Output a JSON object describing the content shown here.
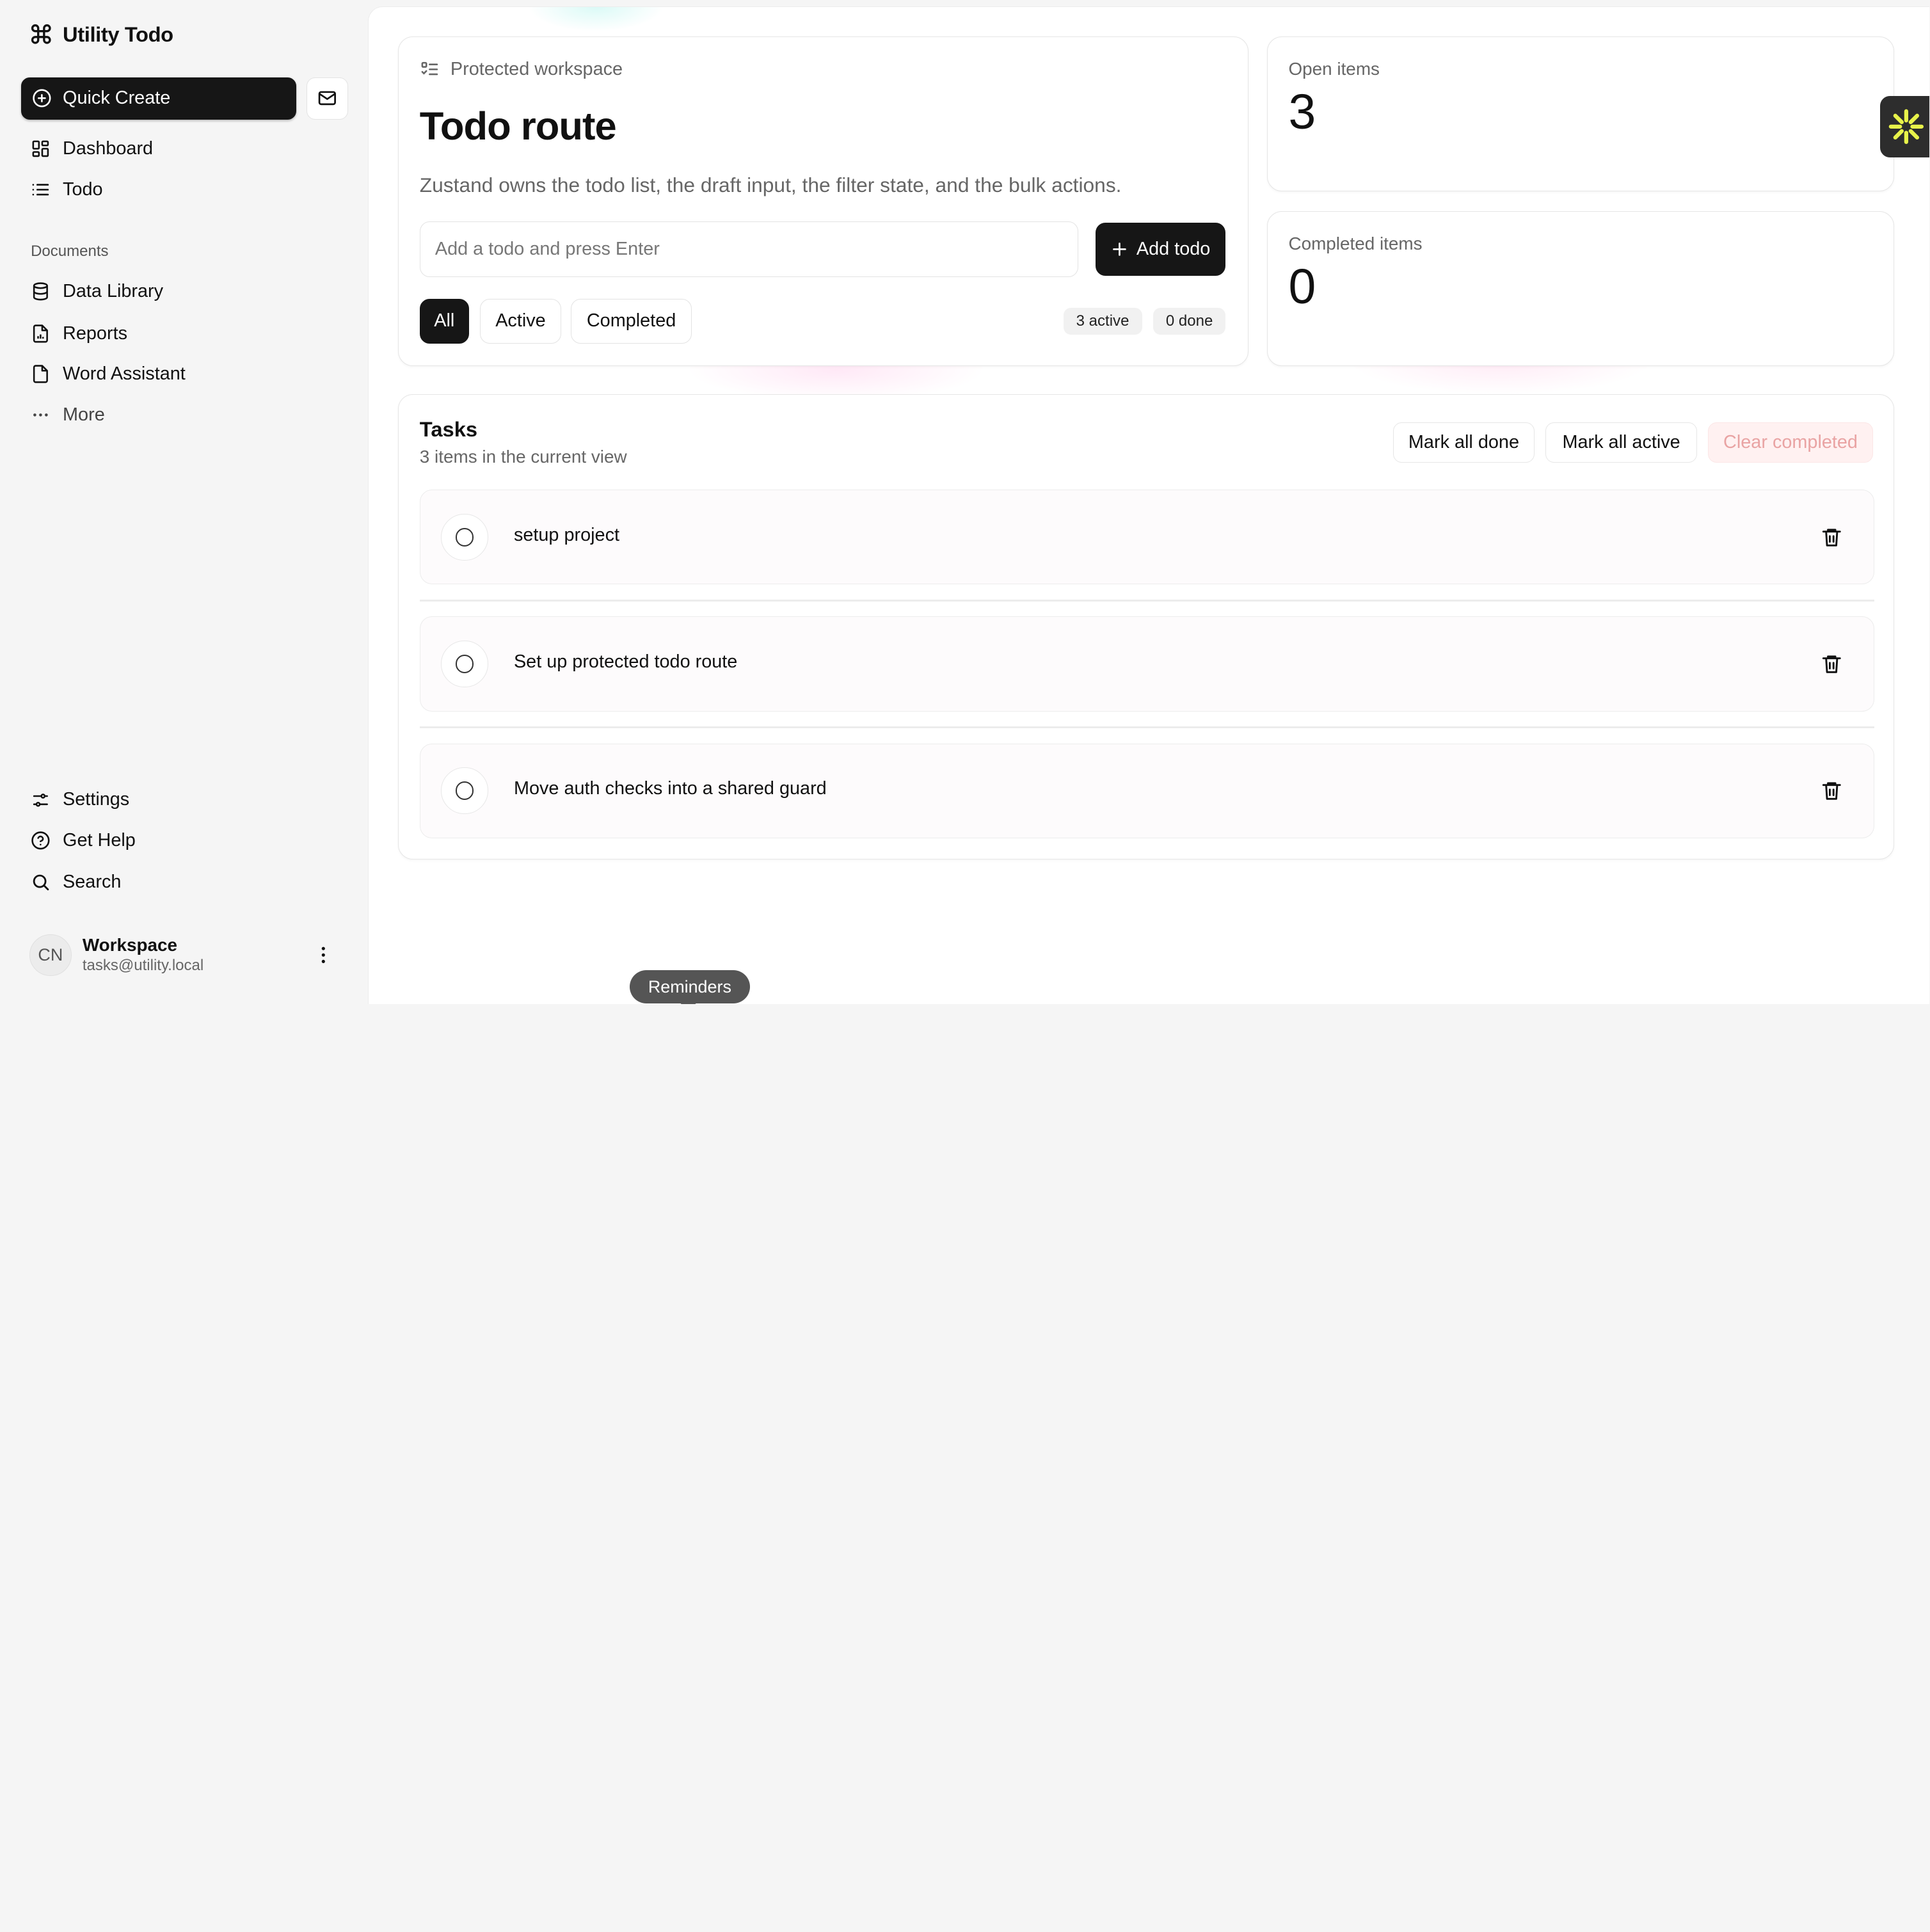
{
  "brand": {
    "name": "Utility Todo"
  },
  "sidebar": {
    "quick_create": "Quick Create",
    "nav": [
      {
        "label": "Dashboard",
        "icon": "dashboard-icon"
      },
      {
        "label": "Todo",
        "icon": "list-icon"
      }
    ],
    "documents_label": "Documents",
    "documents": [
      {
        "label": "Data Library",
        "icon": "database-icon"
      },
      {
        "label": "Reports",
        "icon": "report-icon"
      },
      {
        "label": "Word Assistant",
        "icon": "file-icon"
      },
      {
        "label": "More",
        "icon": "more-horizontal-icon"
      }
    ],
    "bottom": [
      {
        "label": "Settings",
        "icon": "settings-icon"
      },
      {
        "label": "Get Help",
        "icon": "help-icon"
      },
      {
        "label": "Search",
        "icon": "search-icon"
      }
    ],
    "user": {
      "initials": "CN",
      "name": "Workspace",
      "email": "tasks@utility.local"
    }
  },
  "hero": {
    "eyebrow": "Protected workspace",
    "title": "Todo route",
    "description": "Zustand owns the todo list, the draft input, the filter state, and the bulk actions.",
    "input_placeholder": "Add a todo and press Enter",
    "input_value": "",
    "add_label": "Add todo",
    "filters": [
      "All",
      "Active",
      "Completed"
    ],
    "selected_filter": "All",
    "active_pill": "3 active",
    "done_pill": "0 done"
  },
  "stats": {
    "open_label": "Open items",
    "open_value": "3",
    "completed_label": "Completed items",
    "completed_value": "0"
  },
  "tasks": {
    "title": "Tasks",
    "subtitle": "3 items in the current view",
    "mark_all_done": "Mark all done",
    "mark_all_active": "Mark all active",
    "clear_completed": "Clear completed",
    "items": [
      {
        "text": "setup project",
        "done": false
      },
      {
        "text": "Set up protected todo route",
        "done": false
      },
      {
        "text": "Move auth checks into a shared guard",
        "done": false
      }
    ]
  },
  "tooltip": {
    "reminders": "Reminders"
  },
  "colors": {
    "primary": "#161616",
    "danger_bg": "#fff1f1",
    "danger_text": "#e9a3a3",
    "widget_accent": "#e8f34a"
  }
}
